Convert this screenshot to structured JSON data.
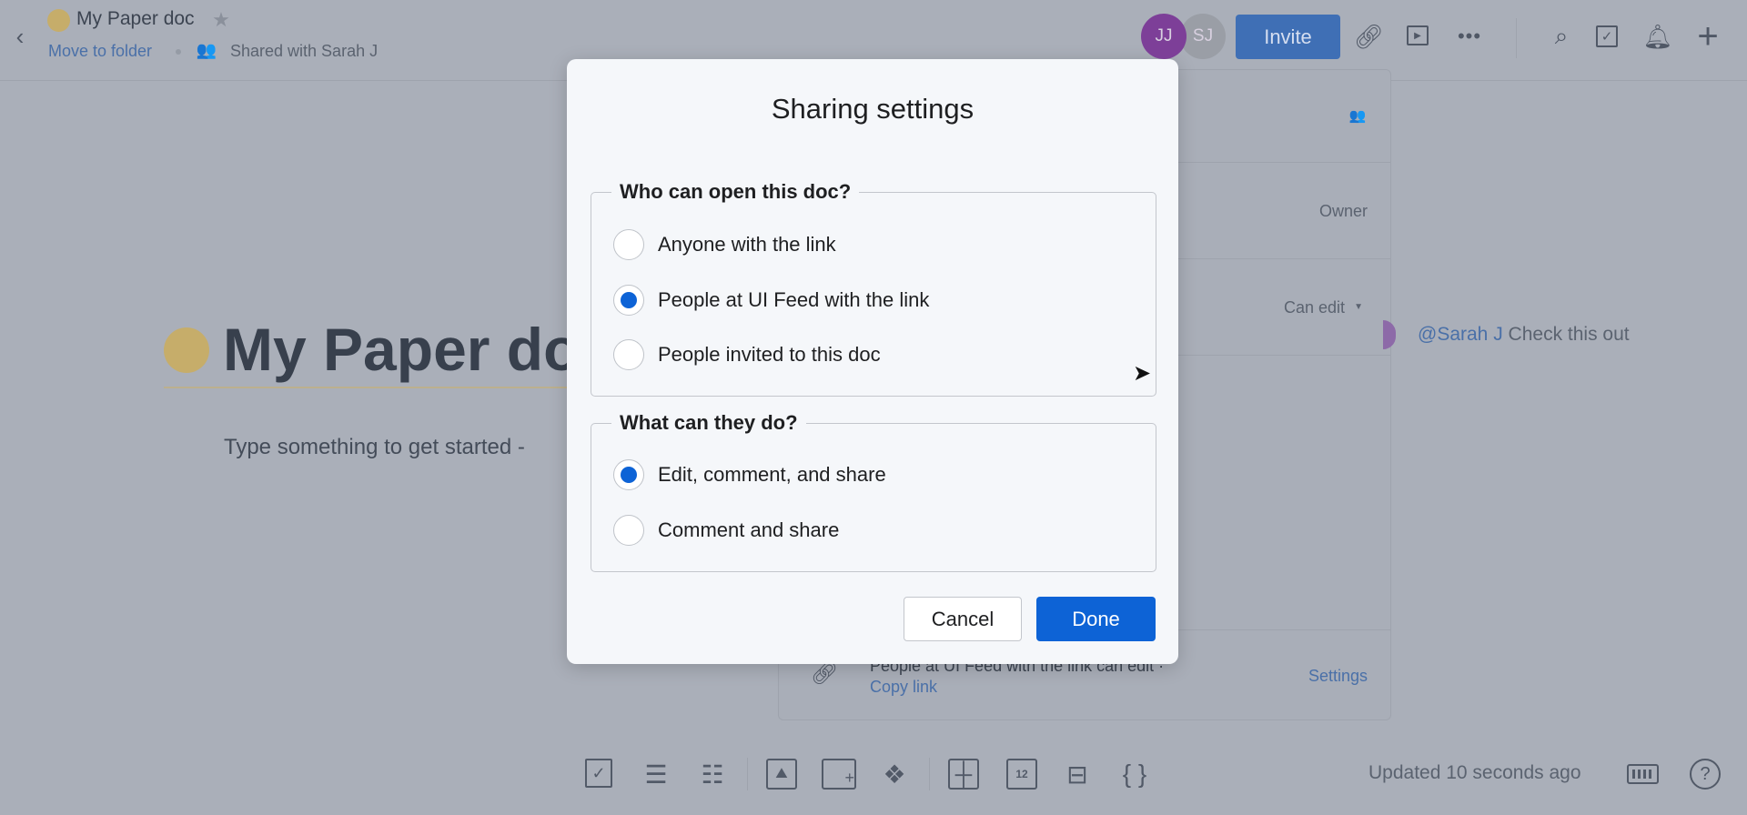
{
  "header": {
    "doc_title": "My Paper doc",
    "move_to_folder": "Move to folder",
    "shared_with": "Shared with Sarah J",
    "avatars": [
      {
        "initials": "JJ",
        "color": "#7d3f98"
      },
      {
        "initials": "SJ",
        "color": "#9a9ea6"
      }
    ],
    "invite": "Invite"
  },
  "doc": {
    "title": "My Paper doc",
    "placeholder": "Type something to get started -",
    "comment_mention": "@Sarah J",
    "comment_text": "Check this out"
  },
  "share_panel": {
    "owner": "Owner",
    "can_edit": "Can edit",
    "link_text": "People at UI Feed with the link can edit ·",
    "copy_link": "Copy link",
    "settings": "Settings"
  },
  "dialog": {
    "title": "Sharing settings",
    "group1": {
      "legend": "Who can open this doc?",
      "options": [
        {
          "label": "Anyone with the link",
          "selected": false
        },
        {
          "label": "People at UI Feed with the link",
          "selected": true
        },
        {
          "label": "People invited to this doc",
          "selected": false
        }
      ]
    },
    "group2": {
      "legend": "What can they do?",
      "options": [
        {
          "label": "Edit, comment, and share",
          "selected": true
        },
        {
          "label": "Comment and share",
          "selected": false
        }
      ]
    },
    "cancel": "Cancel",
    "done": "Done",
    "accent": "#0d63d6"
  },
  "footer": {
    "status": "Updated 10 seconds ago"
  }
}
